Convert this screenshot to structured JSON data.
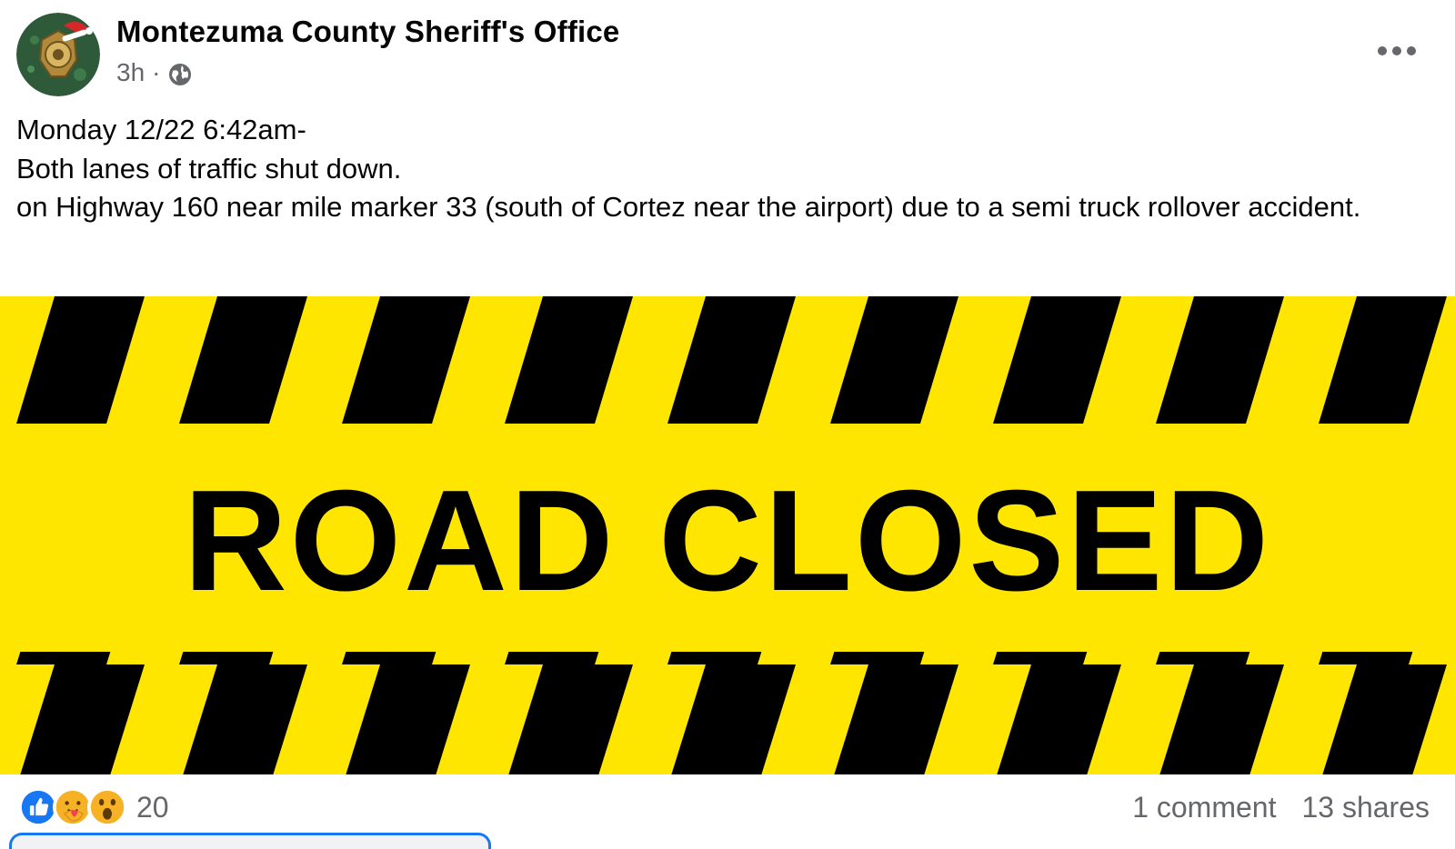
{
  "post": {
    "page_name": "Montezuma County Sheriff's Office",
    "timestamp": "3h",
    "separator": "·",
    "audience_icon": "globe-icon",
    "more_icon": "more-horizontal-icon",
    "text_lines": [
      "Monday 12/22 6:42am-",
      "Both lanes of traffic shut down.",
      "on Highway 160 near mile marker 33 (south of Cortez near the airport) due to a semi truck rollover accident."
    ]
  },
  "image": {
    "headline": "ROAD CLOSED",
    "colors": {
      "yellow": "#ffe600",
      "black": "#000000"
    }
  },
  "reactions": {
    "icons": [
      "like-icon",
      "care-icon",
      "wow-icon"
    ],
    "count": "20",
    "comments": "1 comment",
    "shares": "13 shares"
  },
  "colors": {
    "accent": "#1877f2",
    "secondary_text": "#65676b",
    "like_blue": "#1877f2",
    "emoji_yellow": "#f7b125"
  }
}
